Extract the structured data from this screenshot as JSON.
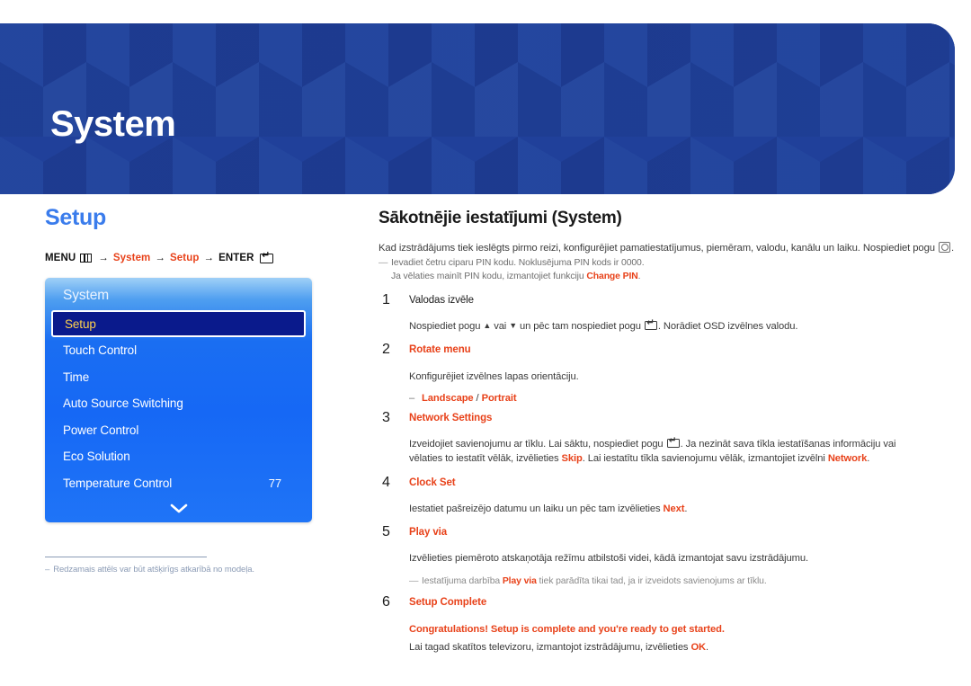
{
  "banner": {
    "title": "System",
    "bg_color": "#20409a",
    "title_color": "#ffffff"
  },
  "left": {
    "section_title": "Setup",
    "section_title_color": "#3a7cec",
    "breadcrumb": {
      "menu_label": "MENU",
      "menu_icon": "menu-grid-icon",
      "arrow": "→",
      "item1": "System",
      "item2": "Setup",
      "enter_label": "ENTER",
      "enter_icon": "enter-key-icon"
    },
    "osd": {
      "header": "System",
      "items": [
        {
          "label": "Setup",
          "value": "",
          "selected": true
        },
        {
          "label": "Touch Control",
          "value": "",
          "selected": false
        },
        {
          "label": "Time",
          "value": "",
          "selected": false
        },
        {
          "label": "Auto Source Switching",
          "value": "",
          "selected": false
        },
        {
          "label": "Power Control",
          "value": "",
          "selected": false
        },
        {
          "label": "Eco Solution",
          "value": "",
          "selected": false
        },
        {
          "label": "Temperature Control",
          "value": "77",
          "selected": false
        }
      ],
      "scroll_icon": "chevron-down-icon",
      "selected_text_color": "#ffd24d",
      "selected_bg_color": "#0a1a8c"
    },
    "footnote": {
      "dash": "–",
      "text": "Redzamais attēls var būt atšķirīgs atkarībā no modeļa."
    }
  },
  "right": {
    "title": "Sākotnējie iestatījumi (System)",
    "intro_before": "Kad izstrādājums tiek ieslēgts pirmo reizi, konfigurējiet pamatiestatījumus, piemēram, valodu, kanālu un laiku.  Nospiediet pogu ",
    "intro_after": ".",
    "intro_icon": "power-button-icon",
    "note_line1": "Ievadiet četru ciparu PIN kodu. Noklusējuma PIN kods ir 0000.",
    "note_line2_before": "Ja vēlaties mainīt PIN kodu, izmantojiet funkciju ",
    "note_line2_link": "Change PIN",
    "note_line2_after": ".",
    "em_dash": "—",
    "steps": [
      {
        "num": "1",
        "head": "Valodas izvēle",
        "head_red": false,
        "body_parts": [
          {
            "t": "text",
            "v": "Nospiediet pogu "
          },
          {
            "t": "glyph",
            "v": "▲"
          },
          {
            "t": "text",
            "v": " vai "
          },
          {
            "t": "glyph",
            "v": "▼"
          },
          {
            "t": "text",
            "v": " un pēc tam nospiediet pogu "
          },
          {
            "t": "icon",
            "v": "enter-key-icon"
          },
          {
            "t": "text",
            "v": ". Norādiet OSD izvēlnes valodu."
          }
        ]
      },
      {
        "num": "2",
        "head": "Rotate menu",
        "head_red": true,
        "body": "Konfigurējiet izvēlnes lapas orientāciju.",
        "bullet_dash": "–",
        "bullet_a": "Landscape",
        "bullet_sep": " / ",
        "bullet_b": "Portrait"
      },
      {
        "num": "3",
        "head": "Network Settings",
        "head_red": true,
        "body_parts": [
          {
            "t": "text",
            "v": "Izveidojiet savienojumu ar tīklu. Lai sāktu, nospiediet pogu "
          },
          {
            "t": "icon",
            "v": "enter-key-icon"
          },
          {
            "t": "text",
            "v": ". Ja nezināt sava tīkla iestatīšanas informāciju vai vēlaties to iestatīt vēlāk, izvēlieties "
          },
          {
            "t": "red",
            "v": "Skip"
          },
          {
            "t": "text",
            "v": ". Lai iestatītu tīkla savienojumu vēlāk, izmantojiet izvēlni "
          },
          {
            "t": "red",
            "v": "Network"
          },
          {
            "t": "text",
            "v": "."
          }
        ]
      },
      {
        "num": "4",
        "head": "Clock Set",
        "head_red": true,
        "body_parts": [
          {
            "t": "text",
            "v": "Iestatiet pašreizējo datumu un laiku un pēc tam izvēlieties "
          },
          {
            "t": "red",
            "v": "Next"
          },
          {
            "t": "text",
            "v": "."
          }
        ]
      },
      {
        "num": "5",
        "head": "Play via",
        "head_red": true,
        "body": "Izvēlieties piemēroto atskaņotāja režīmu atbilstoši videi, kādā izmantojat savu izstrādājumu.",
        "note_parts": [
          {
            "t": "text",
            "v": "Iestatījuma darbība "
          },
          {
            "t": "red",
            "v": "Play via"
          },
          {
            "t": "text",
            "v": " tiek parādīta tikai tad, ja ir izveidots savienojums ar tīklu."
          }
        ]
      },
      {
        "num": "6",
        "head": "Setup Complete",
        "head_red": true,
        "body_bold_red": "Congratulations! Setup is complete and you're ready to get started.",
        "body_parts": [
          {
            "t": "text",
            "v": "Lai tagad skatītos televizoru, izmantojot izstrādājumu, izvēlieties "
          },
          {
            "t": "red",
            "v": "OK"
          },
          {
            "t": "text",
            "v": "."
          }
        ]
      }
    ]
  },
  "colors": {
    "accent_red": "#e8421a",
    "accent_blue": "#3a7cec",
    "banner_blue": "#20409a",
    "osd_blue": "#1668f5"
  }
}
